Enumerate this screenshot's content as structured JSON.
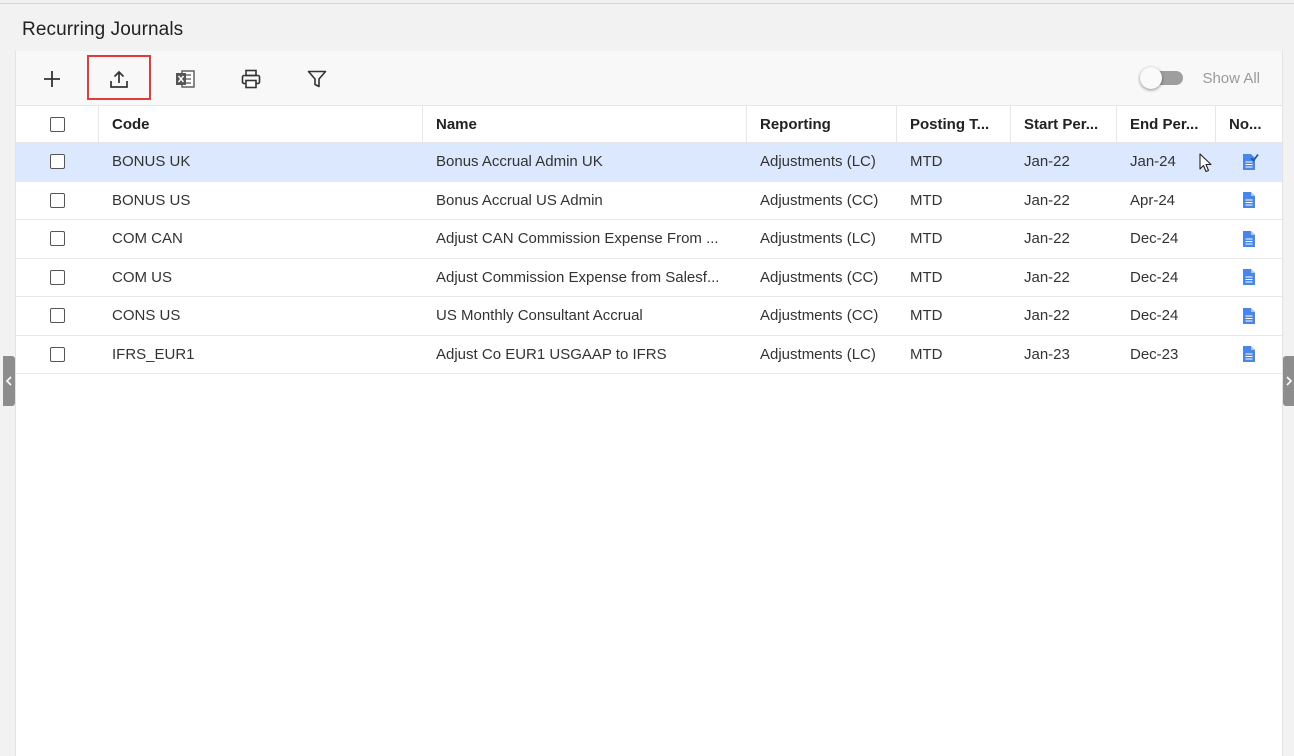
{
  "page": {
    "title": "Recurring Journals"
  },
  "toolbar": {
    "add_icon": "plus-icon",
    "upload_icon": "upload-icon",
    "export_icon": "excel-icon",
    "print_icon": "printer-icon",
    "filter_icon": "filter-icon",
    "show_all_label": "Show All",
    "show_all_on": false
  },
  "colors": {
    "accent": "#2f6fd6",
    "selected_row": "#dbe8fd",
    "highlight": "#e03c3c"
  },
  "grid": {
    "columns": [
      "Code",
      "Name",
      "Reporting",
      "Posting T...",
      "Start Per...",
      "End Per...",
      "No..."
    ],
    "rows": [
      {
        "code": "BONUS UK",
        "name": "Bonus Accrual Admin UK",
        "reporting": "Adjustments (LC)",
        "posting": "MTD",
        "start": "Jan-22",
        "end": "Jan-24",
        "note_icon": "note-checked-icon"
      },
      {
        "code": "BONUS US",
        "name": "Bonus Accrual US Admin",
        "reporting": "Adjustments (CC)",
        "posting": "MTD",
        "start": "Jan-22",
        "end": "Apr-24",
        "note_icon": "note-icon"
      },
      {
        "code": "COM CAN",
        "name": "Adjust CAN Commission Expense From ...",
        "reporting": "Adjustments (LC)",
        "posting": "MTD",
        "start": "Jan-22",
        "end": "Dec-24",
        "note_icon": "note-icon"
      },
      {
        "code": "COM US",
        "name": "Adjust Commission Expense from Salesf...",
        "reporting": "Adjustments (CC)",
        "posting": "MTD",
        "start": "Jan-22",
        "end": "Dec-24",
        "note_icon": "note-icon"
      },
      {
        "code": "CONS US",
        "name": "US Monthly Consultant Accrual",
        "reporting": "Adjustments (CC)",
        "posting": "MTD",
        "start": "Jan-22",
        "end": "Dec-24",
        "note_icon": "note-icon"
      },
      {
        "code": "IFRS_EUR1",
        "name": "Adjust Co EUR1 USGAAP to IFRS",
        "reporting": "Adjustments (LC)",
        "posting": "MTD",
        "start": "Jan-23",
        "end": "Dec-23",
        "note_icon": "note-icon"
      }
    ]
  }
}
